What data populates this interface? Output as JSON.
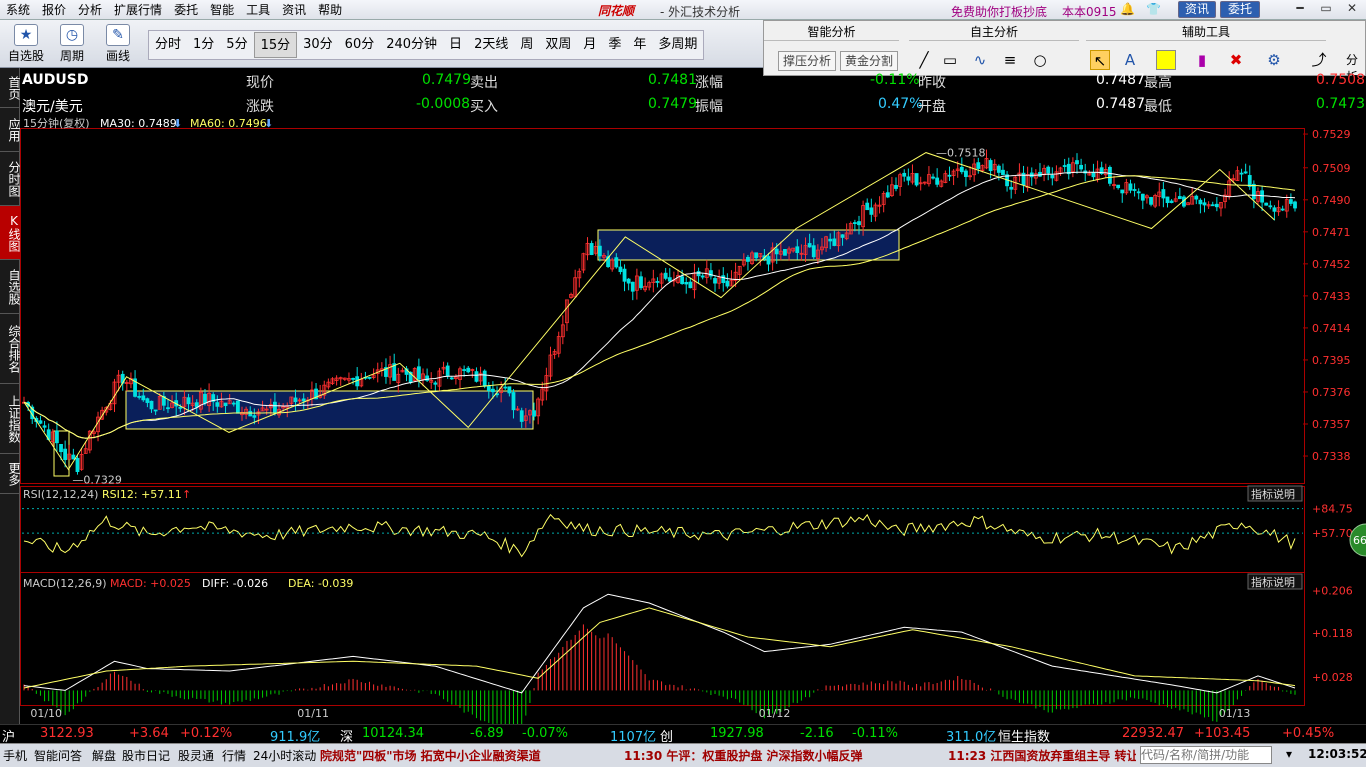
{
  "menu": [
    "系统",
    "报价",
    "分析",
    "扩展行情",
    "委托",
    "智能",
    "工具",
    "资讯",
    "帮助"
  ],
  "brand": "同花顺",
  "app_title": "- 外汇技术分析",
  "promo": "免费助你打板抄底",
  "version": "本本0915",
  "top_buttons": {
    "news": "资讯",
    "trade": "委托"
  },
  "toolbar": {
    "watchlist": "自选股",
    "period": "周期",
    "draw": "画线"
  },
  "periods": [
    "分时",
    "1分",
    "5分",
    "15分",
    "30分",
    "60分",
    "240分钟",
    "日",
    "2天线",
    "周",
    "双周",
    "月",
    "季",
    "年",
    "多周期"
  ],
  "selected_period": "15分",
  "right_toolbar": {
    "smart_analysis": "智能分析",
    "self_analysis": "自主分析",
    "aux_tools": "辅助工具",
    "pressure_btn": "撑压分析",
    "golden_btn": "黄金分割",
    "tab": "分析"
  },
  "left_nav": [
    "首页",
    "应用",
    "分时图",
    "K线图",
    "自选股",
    "综合排名",
    "上证指数",
    "更多"
  ],
  "quote": {
    "symbol": "AUDUSD",
    "name": "澳元/美元",
    "now_label": "现价",
    "now": "0.7479",
    "sell_label": "卖出",
    "sell": "0.7481",
    "chgpct_label": "涨幅",
    "chgpct": "-0.11%",
    "prev_label": "昨收",
    "prev": "0.7487",
    "high_label": "最高",
    "high": "0.7508",
    "chg_label": "涨跌",
    "chg": "-0.0008",
    "buy_label": "买入",
    "buy": "0.7479",
    "amp_label": "振幅",
    "amp": "0.47%",
    "open_label": "开盘",
    "open": "0.7487",
    "low_label": "最低",
    "low": "0.7473"
  },
  "ma_legend": {
    "period": "15分钟(复权)",
    "ma30": "MA30: 0.7489",
    "ma60": "MA60: 0.7496"
  },
  "rsi_legend": {
    "title": "RSI(12,12,24)",
    "rsi12": "RSI12: +57.11"
  },
  "macd_legend": {
    "title": "MACD(12,26,9)",
    "macd": "MACD: +0.025",
    "diff": "DIFF: -0.026",
    "dea": "DEA: -0.039"
  },
  "indicator_note": "指标说明",
  "badge": "66",
  "colors": {
    "up": "#ff3030",
    "down": "#00e0e0",
    "ma": "#ffffff",
    "ma2": "#ffff66",
    "box": "#0a1f5a"
  },
  "chart_data": {
    "type": "candlestick",
    "price_axis_ticks": [
      "0.7529",
      "0.7509",
      "0.7490",
      "0.7471",
      "0.7452",
      "0.7433",
      "0.7414",
      "0.7395",
      "0.7376",
      "0.7357",
      "0.7338"
    ],
    "ylim": [
      0.7322,
      0.7532
    ],
    "date_ticks": [
      "01/10",
      "01/11",
      "01/12",
      "01/13"
    ],
    "annotations": {
      "max_label": "0.7518",
      "min_label": "0.7329"
    },
    "rsi_ticks": [
      "+84.75",
      "+57.70"
    ],
    "rsi_ylim": [
      15,
      92
    ],
    "macd_ticks": [
      "+0.206",
      "+0.118",
      "+0.028"
    ],
    "macd_ylim": [
      -0.03,
      0.215
    ],
    "close_anchors": [
      [
        0,
        0.737
      ],
      [
        6,
        0.7352
      ],
      [
        10,
        0.7338
      ],
      [
        13,
        0.7333
      ],
      [
        16,
        0.7351
      ],
      [
        20,
        0.737
      ],
      [
        24,
        0.7385
      ],
      [
        30,
        0.7368
      ],
      [
        36,
        0.7369
      ],
      [
        44,
        0.7372
      ],
      [
        52,
        0.7367
      ],
      [
        60,
        0.7364
      ],
      [
        68,
        0.7373
      ],
      [
        76,
        0.738
      ],
      [
        84,
        0.7387
      ],
      [
        92,
        0.7388
      ],
      [
        98,
        0.7382
      ],
      [
        104,
        0.7389
      ],
      [
        110,
        0.7385
      ],
      [
        116,
        0.7378
      ],
      [
        121,
        0.7363
      ],
      [
        124,
        0.7366
      ],
      [
        128,
        0.7395
      ],
      [
        133,
        0.7438
      ],
      [
        137,
        0.7465
      ],
      [
        142,
        0.7452
      ],
      [
        148,
        0.744
      ],
      [
        154,
        0.7446
      ],
      [
        160,
        0.744
      ],
      [
        166,
        0.7445
      ],
      [
        170,
        0.7437
      ],
      [
        176,
        0.7453
      ],
      [
        184,
        0.7458
      ],
      [
        190,
        0.7459
      ],
      [
        196,
        0.7464
      ],
      [
        202,
        0.7478
      ],
      [
        208,
        0.749
      ],
      [
        214,
        0.7503
      ],
      [
        220,
        0.7501
      ],
      [
        226,
        0.7508
      ],
      [
        232,
        0.7509
      ],
      [
        236,
        0.7512
      ],
      [
        240,
        0.75
      ],
      [
        246,
        0.7507
      ],
      [
        252,
        0.7505
      ],
      [
        258,
        0.751
      ],
      [
        264,
        0.7502
      ],
      [
        270,
        0.7493
      ],
      [
        276,
        0.749
      ],
      [
        282,
        0.749
      ],
      [
        288,
        0.7486
      ],
      [
        292,
        0.7494
      ],
      [
        296,
        0.7506
      ],
      [
        300,
        0.7491
      ],
      [
        306,
        0.7486
      ],
      [
        309,
        0.7484
      ]
    ],
    "candle_count": 310,
    "rsi_anchors": [
      [
        0,
        50
      ],
      [
        10,
        38
      ],
      [
        20,
        72
      ],
      [
        30,
        56
      ],
      [
        40,
        66
      ],
      [
        60,
        55
      ],
      [
        80,
        66
      ],
      [
        100,
        60
      ],
      [
        112,
        55
      ],
      [
        121,
        37
      ],
      [
        128,
        78
      ],
      [
        136,
        62
      ],
      [
        150,
        60
      ],
      [
        170,
        55
      ],
      [
        190,
        66
      ],
      [
        205,
        74
      ],
      [
        212,
        60
      ],
      [
        232,
        72
      ],
      [
        246,
        52
      ],
      [
        262,
        56
      ],
      [
        280,
        40
      ],
      [
        296,
        70
      ],
      [
        309,
        46
      ]
    ],
    "diff_anchors": [
      [
        0,
        0.01
      ],
      [
        10,
        0.0
      ],
      [
        22,
        0.06
      ],
      [
        30,
        0.045
      ],
      [
        50,
        0.04
      ],
      [
        80,
        0.07
      ],
      [
        100,
        0.05
      ],
      [
        121,
        -0.005
      ],
      [
        136,
        0.17
      ],
      [
        142,
        0.198
      ],
      [
        152,
        0.18
      ],
      [
        170,
        0.12
      ],
      [
        180,
        0.08
      ],
      [
        196,
        0.095
      ],
      [
        214,
        0.13
      ],
      [
        228,
        0.12
      ],
      [
        250,
        0.05
      ],
      [
        280,
        0.01
      ],
      [
        290,
        -0.005
      ],
      [
        300,
        0.03
      ],
      [
        309,
        0.005
      ]
    ],
    "dea_anchors": [
      [
        0,
        0.005
      ],
      [
        20,
        0.04
      ],
      [
        40,
        0.05
      ],
      [
        80,
        0.06
      ],
      [
        110,
        0.05
      ],
      [
        125,
        0.025
      ],
      [
        140,
        0.14
      ],
      [
        152,
        0.17
      ],
      [
        176,
        0.11
      ],
      [
        196,
        0.09
      ],
      [
        216,
        0.125
      ],
      [
        240,
        0.09
      ],
      [
        270,
        0.03
      ],
      [
        300,
        0.02
      ],
      [
        309,
        0.01
      ]
    ]
  },
  "status": {
    "sh_label": "沪",
    "sh": "3122.93",
    "sh_chg": "+3.64",
    "sh_pct": "+0.12%",
    "sh_amt": "911.9亿",
    "sz_label": "深",
    "sz": "10124.34",
    "sz_chg": "-6.89",
    "sz_pct": "-0.07%",
    "sz_amt": "1107亿",
    "cy_label": "创",
    "cy": "1927.98",
    "cy_chg": "-2.16",
    "cy_pct": "-0.11%",
    "cy_amt": "311.0亿",
    "hs_label": "恒生指数",
    "hs": "22932.47",
    "hs_chg": "+103.45",
    "hs_pct": "+0.45%"
  },
  "bottom": {
    "items": [
      "手机",
      "智能问答",
      "解盘",
      "股市日记",
      "股灵通",
      "行情",
      "24小时滚动"
    ],
    "news1": "院规范\"四板\"市场 拓宽中小企业融资渠道",
    "news2": "11:30 午评：权重股护盘 沪深指数小幅反弹",
    "news3": "11:23 江西国资放弃重组主导 转让",
    "search_placeholder": "代码/名称/简拼/功能",
    "clock": "12:03:52"
  }
}
